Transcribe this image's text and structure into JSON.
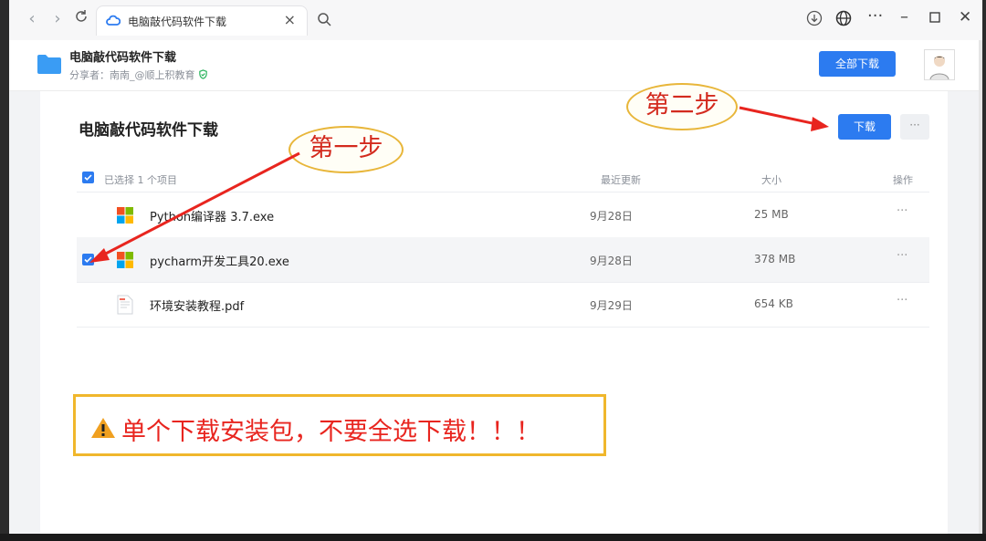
{
  "browser": {
    "tab_title": "电脑敲代码软件下载",
    "tab_close": "×"
  },
  "header": {
    "title": "电脑敲代码软件下载",
    "sharer": "分享者：南南_@顺上积教育",
    "download_all_label": "全部下载"
  },
  "panel": {
    "title": "电脑敲代码软件下载",
    "download_label": "下载",
    "more_label": "···",
    "selected_text": "已选择 1 个项目",
    "columns": {
      "updated": "最近更新",
      "size": "大小",
      "actions": "操作"
    },
    "files": [
      {
        "name": "Python编译器 3.7.exe",
        "date": "9月28日",
        "size": "25 MB",
        "op": "···",
        "selected": false
      },
      {
        "name": "pycharm开发工具20.exe",
        "date": "9月28日",
        "size": "378 MB",
        "op": "···",
        "selected": true
      },
      {
        "name": "环境安装教程.pdf",
        "date": "9月29日",
        "size": "654 KB",
        "op": "···",
        "selected": false
      }
    ]
  },
  "annotations": {
    "step1": "第一步",
    "step2": "第二步",
    "warning": "单个下载安装包，不要全选下载！！！"
  },
  "colors": {
    "accent": "#2c7bf0",
    "annotation_red": "#d32a1e",
    "bubble_border": "#e8b63a"
  }
}
